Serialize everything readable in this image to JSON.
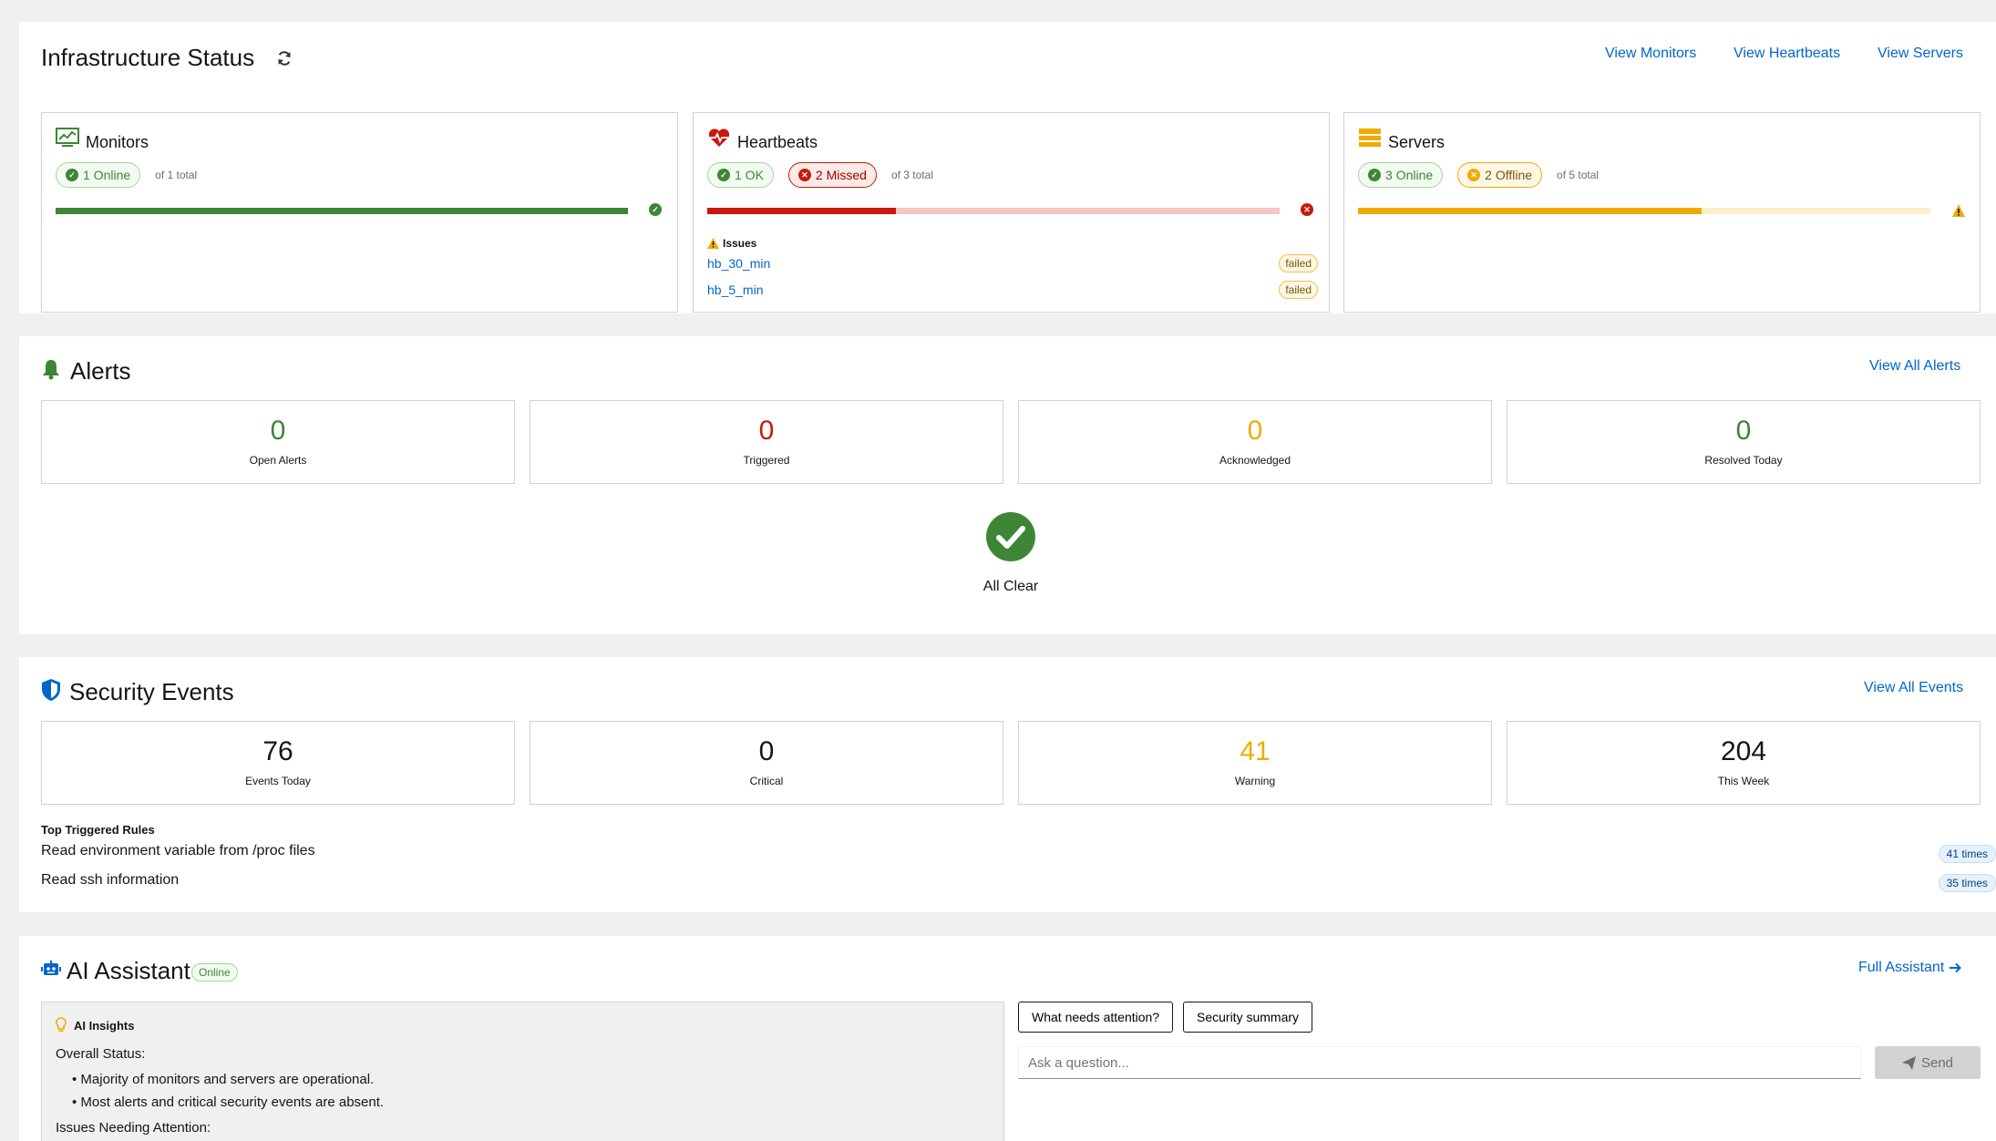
{
  "infrastructure": {
    "title": "Infrastructure Status",
    "links": {
      "monitors": "View Monitors",
      "heartbeats": "View Heartbeats",
      "servers": "View Servers"
    },
    "monitors": {
      "title": "Monitors",
      "online": "1 Online",
      "total": "of 1 total",
      "progress_fraction": 1.0
    },
    "heartbeats": {
      "title": "Heartbeats",
      "ok": "1 OK",
      "missed": "2 Missed",
      "total": "of 3 total",
      "progress_fraction": 0.33,
      "issues_label": "Issues",
      "issues": [
        {
          "name": "hb_30_min",
          "status": "failed"
        },
        {
          "name": "hb_5_min",
          "status": "failed"
        }
      ]
    },
    "servers": {
      "title": "Servers",
      "online": "3 Online",
      "offline": "2 Offline",
      "total": "of 5 total",
      "progress_fraction": 0.6
    }
  },
  "alerts": {
    "title": "Alerts",
    "link": "View All Alerts",
    "stats": [
      {
        "value": "0",
        "label": "Open Alerts",
        "color": "#3e8635"
      },
      {
        "value": "0",
        "label": "Triggered",
        "color": "#c9190b"
      },
      {
        "value": "0",
        "label": "Acknowledged",
        "color": "#f0ab00"
      },
      {
        "value": "0",
        "label": "Resolved Today",
        "color": "#3e8635"
      }
    ],
    "all_clear": "All Clear"
  },
  "security": {
    "title": "Security Events",
    "link": "View All Events",
    "stats": [
      {
        "value": "76",
        "label": "Events Today",
        "color": "#151515"
      },
      {
        "value": "0",
        "label": "Critical",
        "color": "#151515"
      },
      {
        "value": "41",
        "label": "Warning",
        "color": "#f0ab00"
      },
      {
        "value": "204",
        "label": "This Week",
        "color": "#151515"
      }
    ],
    "top_rules_label": "Top Triggered Rules",
    "rules": [
      {
        "name": "Read environment variable from /proc files",
        "count": "41 times"
      },
      {
        "name": "Read ssh information",
        "count": "35 times"
      }
    ]
  },
  "assistant": {
    "title": "AI Assistant",
    "status": "Online",
    "link": "Full Assistant",
    "insights_title": "AI Insights",
    "overall_label": "Overall Status:",
    "bullets": [
      "Majority of monitors and servers are operational.",
      "Most alerts and critical security events are absent."
    ],
    "issues_label": "Issues Needing Attention:",
    "chips": [
      "What needs attention?",
      "Security summary"
    ],
    "input_placeholder": "Ask a question...",
    "send_label": "Send"
  },
  "colors": {
    "accent": "#0066cc",
    "success": "#3e8635",
    "danger": "#c9190b",
    "warning": "#f0ab00"
  }
}
